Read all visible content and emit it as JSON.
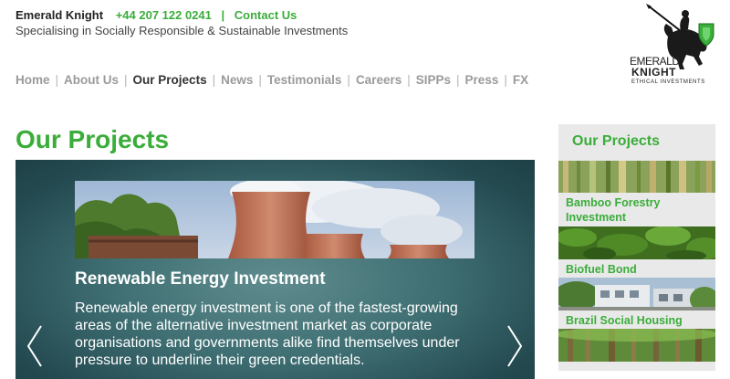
{
  "header": {
    "company": "Emerald Knight",
    "phone": "+44 207 122 0241",
    "separator": "|",
    "contact_label": "Contact Us",
    "tagline": "Specialising in Socially Responsible & Sustainable Investments"
  },
  "logo": {
    "icon": "knight-on-horse-logo",
    "line1": "EMERALD",
    "line2": "KNIGHT",
    "line3": "ETHICAL INVESTMENTS",
    "accent_color": "#3aad3a"
  },
  "nav": {
    "separator": "|",
    "items": [
      {
        "label": "Home"
      },
      {
        "label": "About Us"
      },
      {
        "label": "Our Projects",
        "active": true
      },
      {
        "label": "News"
      },
      {
        "label": "Testimonials"
      },
      {
        "label": "Careers"
      },
      {
        "label": "SIPPs"
      },
      {
        "label": "Press"
      },
      {
        "label": "FX"
      }
    ]
  },
  "page": {
    "title": "Our Projects"
  },
  "slider": {
    "title": "Renewable Energy Investment",
    "text": "Renewable energy investment is one of the fastest-growing areas of the alternative investment market as corporate organisations and governments alike find themselves under pressure to underline their green credentials.",
    "image": "cooling-towers-photo",
    "prev_icon": "chevron-left-icon",
    "next_icon": "chevron-right-icon"
  },
  "sidebar": {
    "heading": "Our Projects",
    "items": [
      {
        "label": "Bamboo Forestry Investment",
        "image": "bamboo-photo"
      },
      {
        "label": "Biofuel Bond",
        "image": "biofuel-plants-photo"
      },
      {
        "label": "Brazil Social Housing",
        "image": "housing-photo"
      }
    ],
    "extra_image": "forest-photo"
  },
  "colors": {
    "brand_green": "#3aad3a",
    "nav_inactive": "#9a9a9a",
    "nav_active": "#333333",
    "slider_bg": "#3f6f73",
    "sidebar_bg": "#e9e9e9"
  }
}
